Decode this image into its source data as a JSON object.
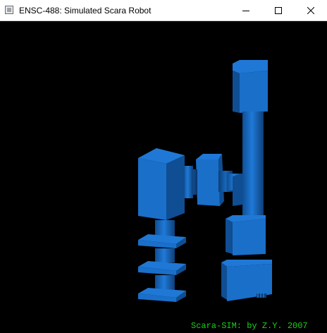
{
  "window": {
    "title": "ENSC-488: Simulated Scara Robot",
    "controls": {
      "minimize": "minimize",
      "maximize": "maximize",
      "close": "close"
    }
  },
  "viewport": {
    "background_color": "#000000",
    "robot_color": "#1a6fc9",
    "footer_text": "Scara-SIM: by Z.Y. 2007",
    "footer_color": "#19d219"
  },
  "icons": {
    "app": "app-window-icon",
    "minimize": "minimize-icon",
    "maximize": "maximize-icon",
    "close": "close-icon"
  }
}
